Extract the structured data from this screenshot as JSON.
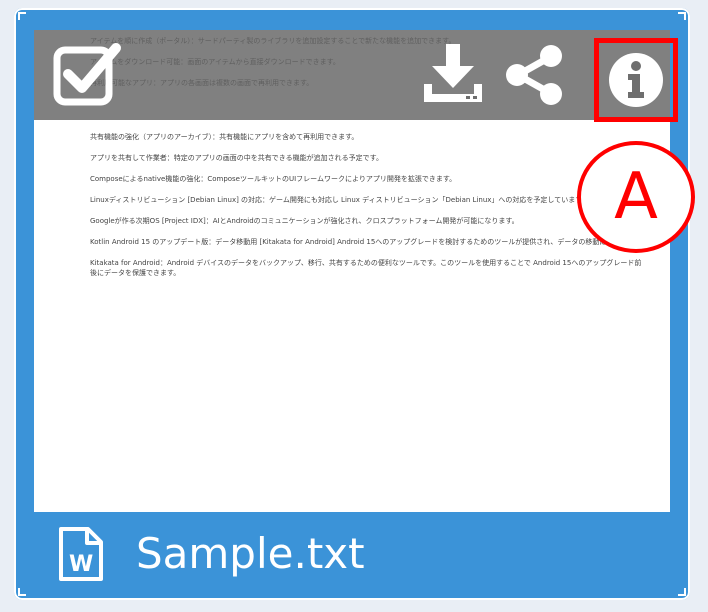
{
  "file": {
    "name": "Sample.txt",
    "preview_paragraphs": [
      "アイテムを順に作成（ポータル）：サードパーティ製のライブラリを追加設定することで新たな機能を追加できます。",
      "アイテムをダウンロード可能：画面のアイテムから直接ダウンロードできます。",
      "再利用可能なアプリ：アプリの各画面は複数の画面で再利用できます。",
      "共有機能の強化（アプリのアーカイブ）：共有機能にアプリを含めて再利用できます。",
      "アプリを共有して作業者：特定のアプリの画面の中を共有できる機能が追加される予定です。",
      "Composeによるnative機能の強化：ComposeツールキットのUIフレームワークによりアプリ開発を拡張できます。",
      "Linuxディストリビューション [Debian Linux] の対応：ゲーム開発にも対応し Linux ディストリビューション「Debian Linux」への対応を予定しています。",
      "Googleが作る次期OS [Project IDX]：AIとAndroidのコミュニケーションが強化され、クロスプラットフォーム開発が可能になります。",
      "Kotlin Android 15 のアップデート版：データ移動用 [Kitakata for Android] Android 15へのアップグレードを検討するためのツールが提供され、データの移動に役立ちます。",
      "Kitakata for Android：Android デバイスのデータをバックアップ、移行、共有するための便利なツールです。このツールを使用することで Android 15へのアップグレード前後にデータを保護できます。"
    ]
  },
  "toolbar": {
    "select_icon": "checkbox-check-icon",
    "download_icon": "download-icon",
    "share_icon": "share-icon",
    "info_icon": "info-icon"
  },
  "annotation": {
    "label": "A",
    "color": "#ff0000"
  },
  "colors": {
    "card_background": "#3b93d8",
    "toolbar_overlay": "#6e6e6e",
    "highlight": "#ff0000"
  }
}
